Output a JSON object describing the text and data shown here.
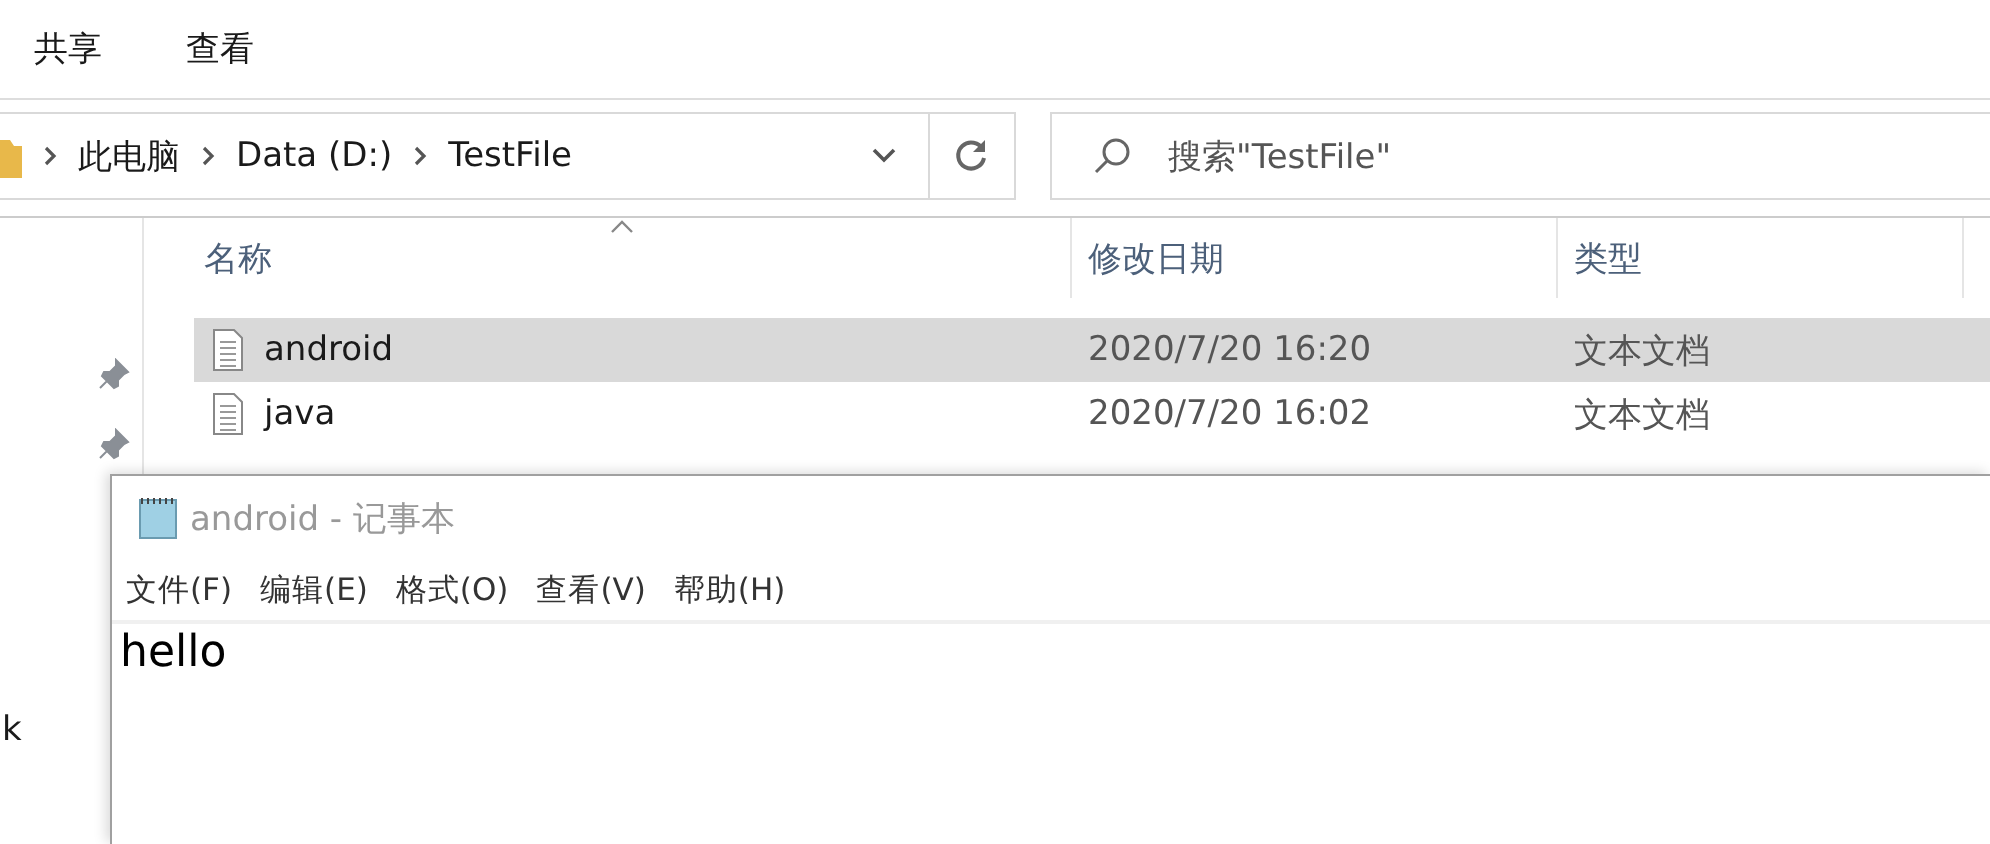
{
  "ribbon": {
    "tabs": [
      {
        "label": "共享"
      },
      {
        "label": "查看"
      }
    ]
  },
  "address_bar": {
    "path": [
      "此电脑",
      "Data (D:)",
      "TestFile"
    ]
  },
  "search": {
    "placeholder": "搜索\"TestFile\""
  },
  "nav_pane": {
    "items": [
      {
        "label": "k"
      }
    ]
  },
  "file_list": {
    "columns": [
      "名称",
      "修改日期",
      "类型"
    ],
    "rows": [
      {
        "name": "android",
        "modified": "2020/7/20 16:20",
        "type": "文本文档",
        "selected": true
      },
      {
        "name": "java",
        "modified": "2020/7/20 16:02",
        "type": "文本文档",
        "selected": false
      }
    ]
  },
  "notepad": {
    "title": "android - 记事本",
    "menu": [
      "文件(F)",
      "编辑(E)",
      "格式(O)",
      "查看(V)",
      "帮助(H)"
    ],
    "content": "hello"
  }
}
